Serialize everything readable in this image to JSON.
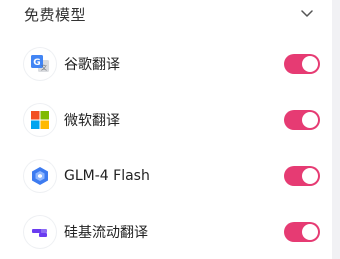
{
  "section": {
    "title": "免费模型",
    "collapse_icon": "chevron-down-icon"
  },
  "colors": {
    "toggle_on": "#e63b73",
    "text": "#222222",
    "title": "#333333"
  },
  "services": [
    {
      "name": "谷歌翻译",
      "icon": "google-translate-icon",
      "enabled": true
    },
    {
      "name": "微软翻译",
      "icon": "microsoft-icon",
      "enabled": true
    },
    {
      "name": "GLM-4 Flash",
      "icon": "glm-icon",
      "enabled": true
    },
    {
      "name": "硅基流动翻译",
      "icon": "siliconflow-icon",
      "enabled": true
    }
  ]
}
